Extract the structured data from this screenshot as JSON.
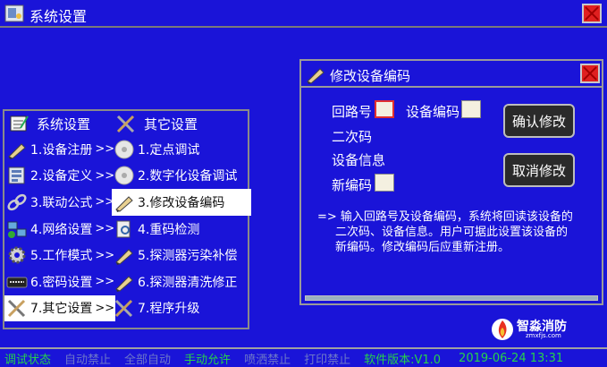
{
  "window": {
    "title": "系统设置",
    "icon": "settings-app-icon"
  },
  "menu": {
    "left_header": "系统设置",
    "right_header": "其它设置",
    "left_items": [
      {
        "label": "1.设备注册",
        "arrow": ">>",
        "icon": "pencil-icon"
      },
      {
        "label": "2.设备定义",
        "arrow": ">>",
        "icon": "device-define-icon"
      },
      {
        "label": "3.联动公式",
        "arrow": ">>",
        "icon": "link-icon"
      },
      {
        "label": "4.网络设置",
        "arrow": ">>",
        "icon": "network-icon"
      },
      {
        "label": "5.工作模式",
        "arrow": ">>",
        "icon": "gear-icon"
      },
      {
        "label": "6.密码设置",
        "arrow": ">>",
        "icon": "keyboard-icon"
      },
      {
        "label": "7.其它设置",
        "arrow": ">>",
        "icon": "tools-icon"
      }
    ],
    "right_items": [
      {
        "label": "1.定点调试",
        "icon": "disc-icon"
      },
      {
        "label": "2.数字化设备调试",
        "icon": "disc-icon"
      },
      {
        "label": "3.修改设备编码",
        "icon": "pencil-icon"
      },
      {
        "label": "4.重码检测",
        "icon": "search-doc-icon"
      },
      {
        "label": "5.探测器污染补偿",
        "icon": "pencil-icon"
      },
      {
        "label": "6.探测器清洗修正",
        "icon": "pencil-icon"
      },
      {
        "label": "7.程序升级",
        "icon": "tools-icon"
      }
    ]
  },
  "dialog": {
    "title": "修改设备编码",
    "loop_label": "回路号",
    "code_label": "设备编码",
    "secondary_label": "二次码",
    "info_label": "设备信息",
    "new_code_label": "新编码",
    "confirm": "确认修改",
    "cancel": "取消修改",
    "note_line1": "=>  输入回路号及设备编码，系统将回读该设备的",
    "note_line2": "二次码、设备信息。用户可据此设置该设备的",
    "note_line3": "新编码。修改编码后应重新注册。"
  },
  "logo": {
    "name": "智淼消防",
    "url": "zmxfjs.com"
  },
  "status": {
    "debug": "调试状态",
    "auto_forbid": "自动禁止",
    "all_auto": "全部自动",
    "manual_allow": "手动允许",
    "spray_forbid": "喷洒禁止",
    "print_forbid": "打印禁止",
    "version": "软件版本:V1.0",
    "datetime": "2019-06-24 13:31"
  },
  "colors": {
    "background": "#1a14d8",
    "status_active": "#26d34a",
    "status_inactive": "#6d78c8",
    "close": "#e02020",
    "selected_item": "#ffffff"
  }
}
